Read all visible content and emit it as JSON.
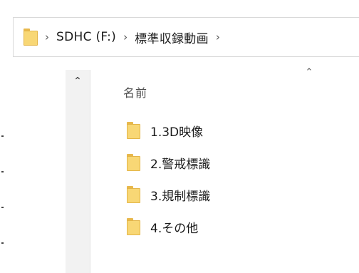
{
  "address_bar": {
    "folder_icon": "folder-icon",
    "separator": "›",
    "crumbs": [
      "SDHC (F:)",
      "標準収録動画"
    ],
    "trailing_chevron": "›"
  },
  "nav_pane": {
    "collapse_icon": "chevron-up-icon",
    "collapse_glyph": "⌃"
  },
  "column_header": {
    "name_label": "名前",
    "sort_icon": "sort-ascending-icon",
    "sort_glyph": "⌃"
  },
  "file_list": {
    "items": [
      {
        "name": "1.3D映像",
        "type": "folder"
      },
      {
        "name": "2.警戒標識",
        "type": "folder"
      },
      {
        "name": "3.規制標識",
        "type": "folder"
      },
      {
        "name": "4.その他",
        "type": "folder"
      }
    ]
  },
  "colors": {
    "folder_fill": "#f8d775",
    "folder_border": "#e3b548",
    "nav_pane_bg": "#f2f2f2",
    "address_border": "#d9d9d9"
  }
}
